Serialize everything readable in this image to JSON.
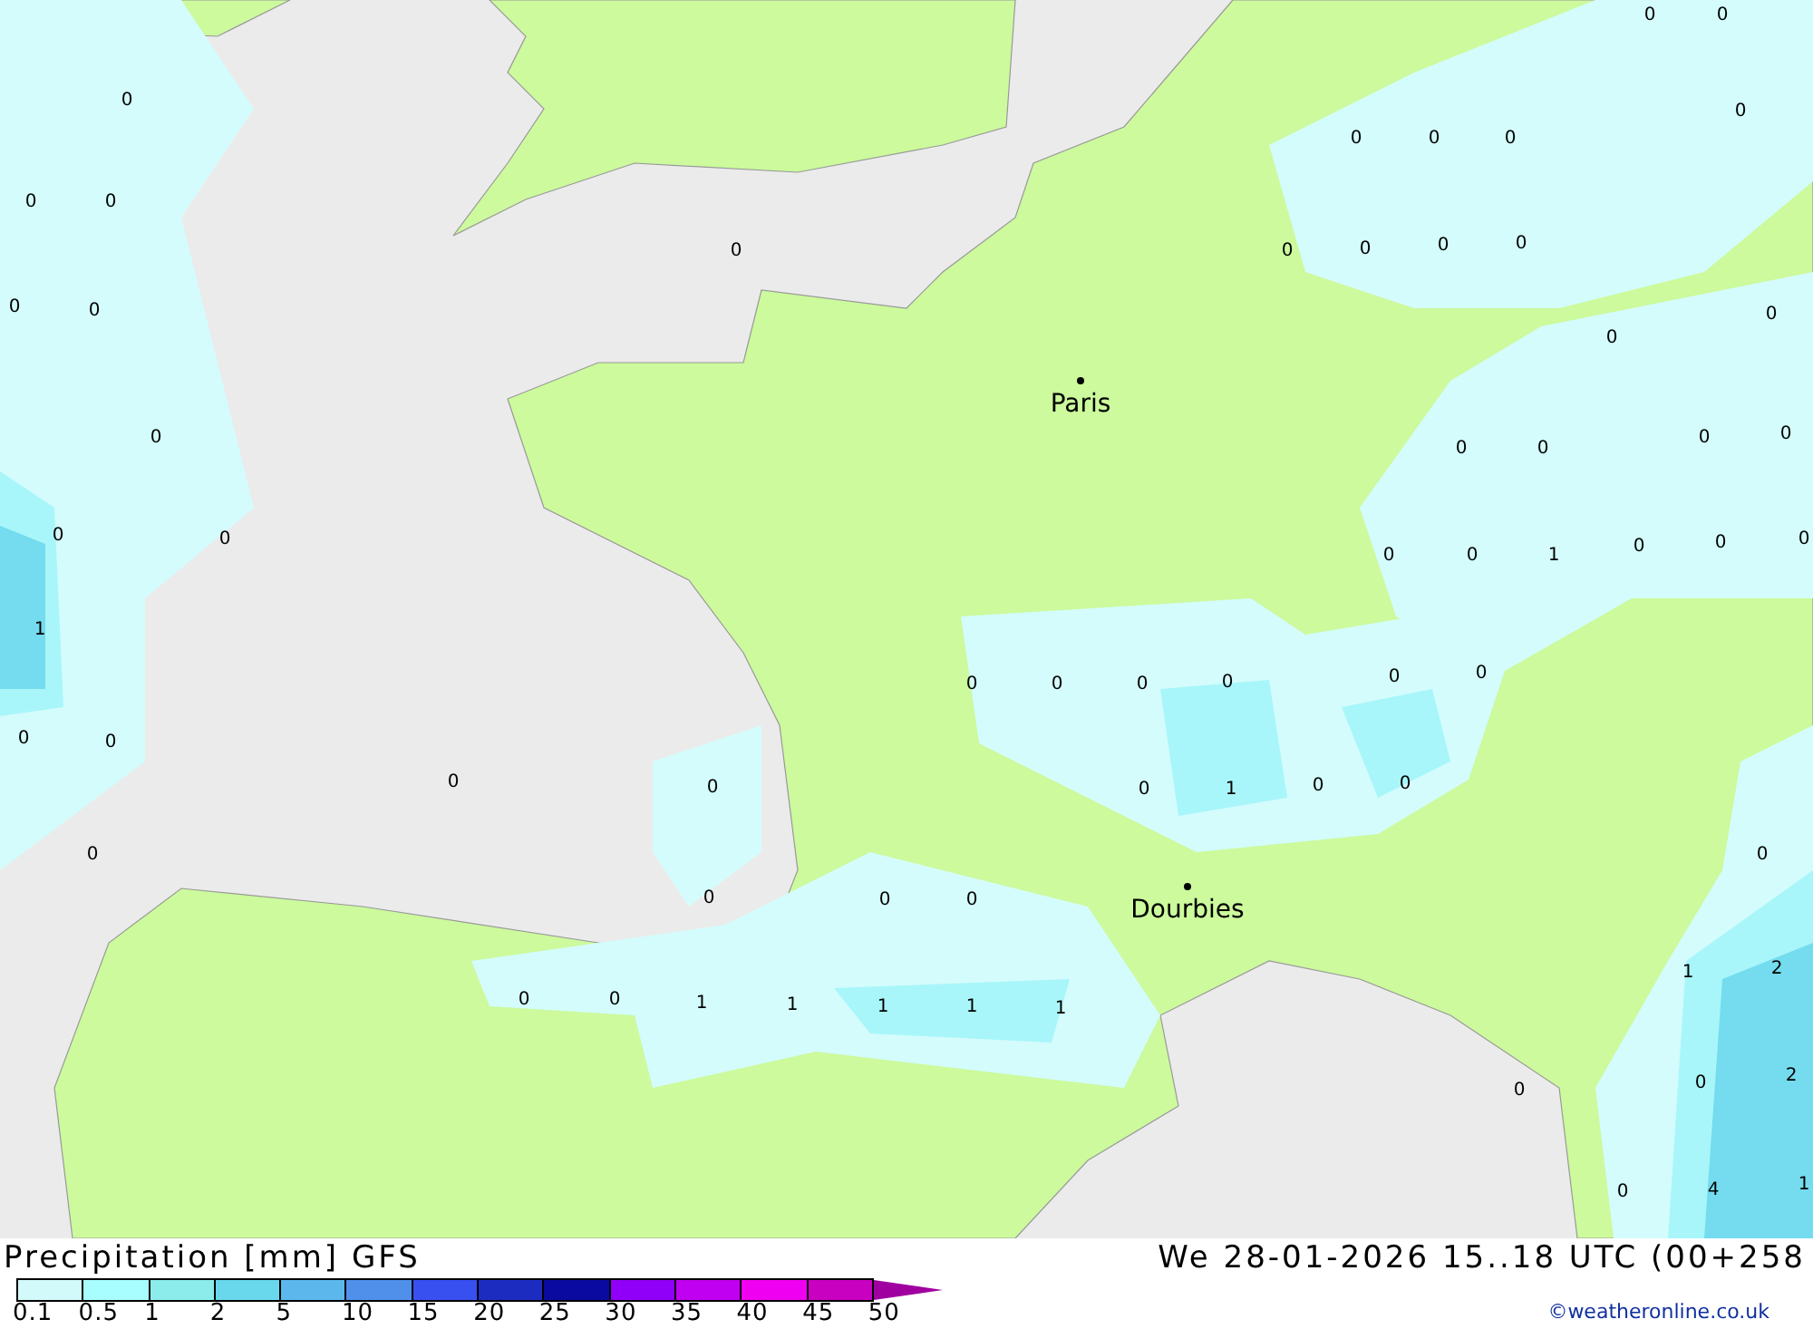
{
  "map": {
    "cities": [
      {
        "name": "Paris"
      },
      {
        "name": "Dourbies"
      }
    ],
    "values": [
      "0",
      "0",
      "0",
      "0",
      "0",
      "0",
      "0",
      "0",
      "0",
      "0",
      "0",
      "0",
      "0",
      "0",
      "0",
      "0",
      "0",
      "0",
      "0",
      "0",
      "0",
      "0",
      "0",
      "0",
      "0",
      "0",
      "0",
      "1",
      "0",
      "0",
      "0",
      "1",
      "0",
      "0",
      "0",
      "0",
      "0",
      "0",
      "0",
      "0",
      "0",
      "0",
      "0",
      "1",
      "0",
      "0",
      "0",
      "0",
      "0",
      "0",
      "0",
      "1",
      "2",
      "0",
      "0",
      "1",
      "1",
      "1",
      "1",
      "1",
      "0",
      "0",
      "2",
      "0",
      "4",
      "1"
    ]
  },
  "legend": {
    "title": "Precipitation [mm] GFS",
    "run": "We 28-01-2026 15..18 UTC (00+258",
    "swatches": [
      {
        "color": "#d2fafa"
      },
      {
        "color": "#a8fefe"
      },
      {
        "color": "#8cecec"
      },
      {
        "color": "#6ad8ec"
      },
      {
        "color": "#5cb8ec"
      },
      {
        "color": "#5090ea"
      },
      {
        "color": "#3850f0"
      },
      {
        "color": "#1c2cc0"
      },
      {
        "color": "#0a0aa0"
      },
      {
        "color": "#9000f8"
      },
      {
        "color": "#c000f0"
      },
      {
        "color": "#f000f0"
      },
      {
        "color": "#c800c0"
      },
      {
        "color": "#a000a0",
        "kind": "arrow"
      }
    ],
    "ticks": [
      "0.1",
      "0.5",
      "1",
      "2",
      "5",
      "10",
      "15",
      "20",
      "25",
      "30",
      "35",
      "40",
      "45",
      "50"
    ],
    "credit": "©weatheronline.co.uk"
  }
}
